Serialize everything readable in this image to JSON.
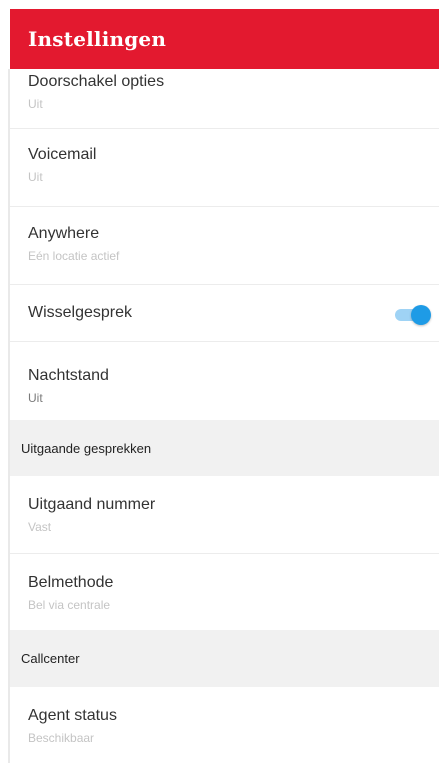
{
  "header": {
    "title": "Instellingen"
  },
  "settings": [
    {
      "label": "Doorschakel opties",
      "value": "Uit"
    },
    {
      "label": "Voicemail",
      "value": "Uit"
    },
    {
      "label": "Anywhere",
      "value": "Eén locatie actief"
    },
    {
      "label": "Wisselgesprek",
      "toggle_on": true
    },
    {
      "label": "Nachtstand",
      "value": "Uit"
    }
  ],
  "sections": [
    {
      "title": "Uitgaande gesprekken",
      "items": [
        {
          "label": "Uitgaand nummer",
          "value": "Vast"
        },
        {
          "label": "Belmethode",
          "value": "Bel via centrale"
        }
      ]
    },
    {
      "title": "Callcenter",
      "items": [
        {
          "label": "Agent status",
          "value": "Beschikbaar"
        }
      ]
    }
  ],
  "colors": {
    "header": "#e3192f",
    "toggle": "#1e9be6",
    "section_bg": "#f1f1f1"
  }
}
